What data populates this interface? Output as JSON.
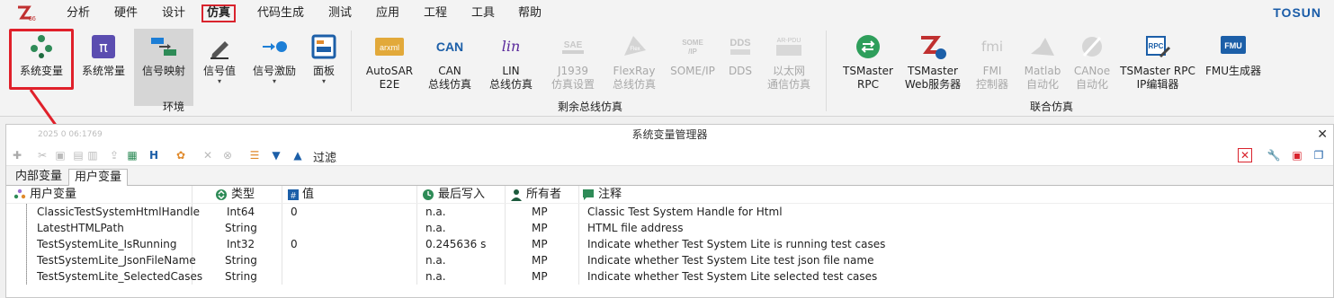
{
  "menu": {
    "items": [
      "分析",
      "硬件",
      "设计",
      "仿真",
      "代码生成",
      "测试",
      "应用",
      "工程",
      "工具",
      "帮助"
    ],
    "active_index": 3,
    "brand": "TOSUN"
  },
  "ribbon": {
    "env_buttons": [
      {
        "label": "系统变量",
        "icon": "dots-icon"
      },
      {
        "label": "系统常量",
        "icon": "pi-icon"
      },
      {
        "label": "信号映射",
        "icon": "mapping-icon"
      },
      {
        "label": "信号值",
        "icon": "pencil-icon"
      },
      {
        "label": "信号激励",
        "icon": "stimulus-icon"
      },
      {
        "label": "面板",
        "icon": "panel-icon"
      }
    ],
    "env_group_label": "环境",
    "bus_buttons": [
      {
        "label1": "AutoSAR",
        "label2": "E2E",
        "icon_text": "arxml"
      },
      {
        "label1": "CAN",
        "label2": "总线仿真",
        "icon_text": "CAN"
      },
      {
        "label1": "LIN",
        "label2": "总线仿真",
        "icon_text": "lin"
      },
      {
        "label1": "J1939",
        "label2": "仿真设置",
        "icon_text": "SAE"
      },
      {
        "label1": "FlexRay",
        "label2": "总线仿真",
        "icon_text": "Flex"
      },
      {
        "label1": "SOME/IP",
        "label2": "",
        "icon_text": "SOME"
      },
      {
        "label1": "DDS",
        "label2": "",
        "icon_text": "DDS"
      },
      {
        "label1": "以太网",
        "label2": "通信仿真",
        "icon_text": "AR-PDU"
      }
    ],
    "bus_group_label": "剩余总线仿真",
    "co_buttons": [
      {
        "label1": "TSMaster",
        "label2": "RPC"
      },
      {
        "label1": "TSMaster",
        "label2": "Web服务器"
      },
      {
        "label1": "FMI",
        "label2": "控制器"
      },
      {
        "label1": "Matlab",
        "label2": "自动化"
      },
      {
        "label1": "CANoe",
        "label2": "自动化"
      },
      {
        "label1": "TSMaster RPC",
        "label2": "IP编辑器"
      },
      {
        "label1": "FMU生成器",
        "label2": ""
      }
    ],
    "co_group_label": "联合仿真"
  },
  "panel": {
    "title": "系统变量管理器",
    "timestamp": "2025 0 06:1769",
    "filter_label": "过滤",
    "tabs": [
      "内部变量",
      "用户变量"
    ],
    "active_tab": 1,
    "columns": [
      "用户变量",
      "类型",
      "值",
      "最后写入",
      "所有者",
      "注释"
    ],
    "rows": [
      {
        "name": "ClassicTestSystemHtmlHandle",
        "type": "Int64",
        "value": "0",
        "last": "n.a.",
        "owner": "MP",
        "note": "Classic Test System Handle for Html"
      },
      {
        "name": "LatestHTMLPath",
        "type": "String",
        "value": "",
        "last": "n.a.",
        "owner": "MP",
        "note": "HTML file address"
      },
      {
        "name": "TestSystemLite_IsRunning",
        "type": "Int32",
        "value": "0",
        "last": "0.245636 s",
        "owner": "MP",
        "note": "Indicate whether Test System Lite is running test cases"
      },
      {
        "name": "TestSystemLite_JsonFileName",
        "type": "String",
        "value": "",
        "last": "n.a.",
        "owner": "MP",
        "note": "Indicate whether Test System Lite test json file name"
      },
      {
        "name": "TestSystemLite_SelectedCases",
        "type": "String",
        "value": "",
        "last": "n.a.",
        "owner": "MP",
        "note": "Indicate whether Test System Lite selected test cases"
      }
    ]
  },
  "colors": {
    "accent_red": "#e0202a",
    "brand_blue": "#1a5ca8"
  }
}
